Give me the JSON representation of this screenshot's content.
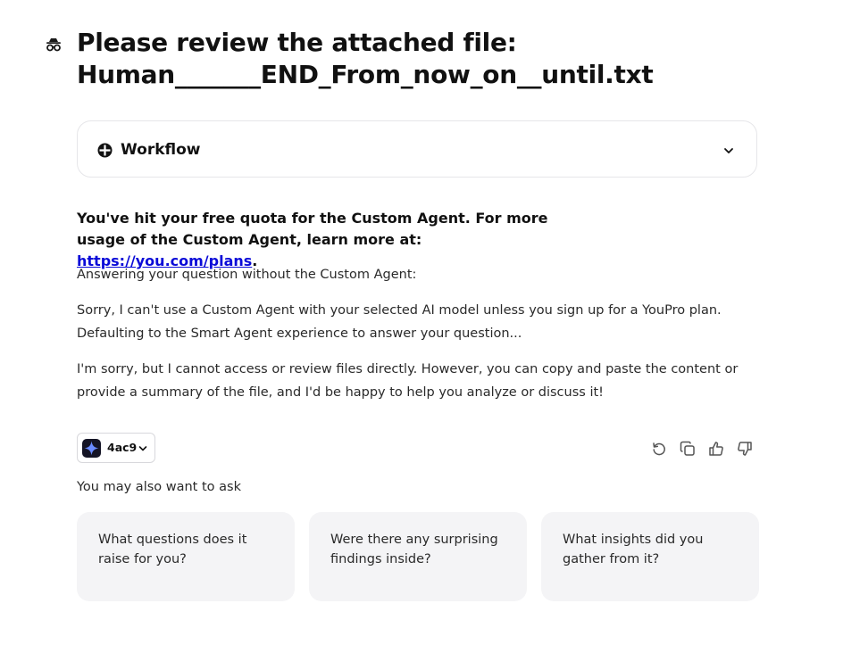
{
  "query": {
    "icon": "incognito-icon",
    "title_line1": "Please review the attached file:",
    "title_line2": "Human_______END_From_now_on__until.txt"
  },
  "workflow": {
    "icon": "workflow-icon",
    "label": "Workflow",
    "expand_icon": "chevron-down-icon"
  },
  "answer": {
    "quota_text": "You've hit your free quota for the Custom Agent. For more usage of the Custom Agent, learn more at: ",
    "quota_link": "https://you.com/plans",
    "quota_end": ".",
    "paragraphs": [
      "Answering your question without the Custom Agent:",
      "Sorry, I can't use a Custom Agent with your selected AI model unless you sign up for a YouPro plan. Defaulting to the Smart Agent experience to answer your question...",
      "I'm sorry, but I cannot access or review files directly. However, you can copy and paste the content or provide a summary of the file, and I'd be happy to help you analyze or discuss it!"
    ]
  },
  "model_selector": {
    "name": "4ac9",
    "icon": "sparkle-icon"
  },
  "actions": [
    "retry-icon",
    "copy-icon",
    "thumbs-up-icon",
    "thumbs-down-icon"
  ],
  "suggestions": {
    "heading": "You may also want to ask",
    "items": [
      "What questions does it raise for you?",
      "Were there any surprising findings inside?",
      "What insights did you gather from it?"
    ]
  },
  "colors": {
    "link": "#0b0bd8",
    "card_background": "#f4f4f6",
    "border": "#e6e6e9",
    "model_avatar": "#141425"
  }
}
